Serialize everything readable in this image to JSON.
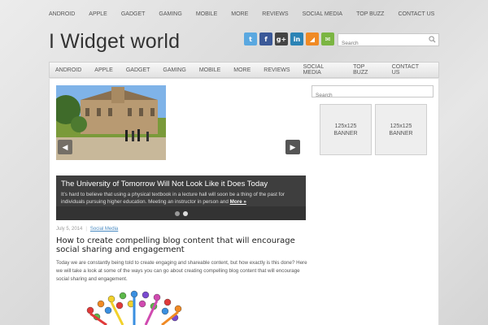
{
  "top_nav": [
    "ANDROID",
    "APPLE",
    "GADGET",
    "GAMING",
    "MOBILE",
    "MORE",
    "REVIEWS",
    "SOCIAL MEDIA",
    "TOP BUZZ",
    "CONTACT US"
  ],
  "site_title": "I Widget world",
  "social_icons": [
    {
      "name": "twitter-icon",
      "glyph": "t",
      "color": "#5aa8e0"
    },
    {
      "name": "facebook-icon",
      "glyph": "f",
      "color": "#3b5998"
    },
    {
      "name": "google-plus-icon",
      "glyph": "g+",
      "color": "#444"
    },
    {
      "name": "linkedin-icon",
      "glyph": "in",
      "color": "#2b83b5"
    },
    {
      "name": "rss-icon",
      "glyph": "◢",
      "color": "#f08a24"
    },
    {
      "name": "email-icon",
      "glyph": "✉",
      "color": "#7bb542"
    }
  ],
  "header_search": {
    "placeholder": "Search"
  },
  "main_nav": [
    "ANDROID",
    "APPLE",
    "GADGET",
    "GAMING",
    "MOBILE",
    "MORE",
    "REVIEWS",
    "SOCIAL MEDIA",
    "TOP BUZZ",
    "CONTACT US"
  ],
  "slider": {
    "title": "The University of Tomorrow Will Not Look Like it Does Today",
    "text": "It’s hard to believe that using a physical textbook in a lecture hall will soon be a thing of the past for individuals pursuing higher education. Meeting an instructor in person and",
    "more_label": "More »",
    "slide_count": 2,
    "active_slide": 1
  },
  "post": {
    "date": "July 5, 2014",
    "separator": "|",
    "category": "Social Media",
    "title": "How to create compelling blog content that will encourage social sharing and engagement",
    "excerpt": "Today we are constantly being told to create engaging and shareable content, but how exactly is this done? Here we will take a look at some of the ways you can go about creating compelling blog content that will encourage social sharing and engagement."
  },
  "sidebar": {
    "search_placeholder": "Search",
    "banners": [
      {
        "size": "125x125",
        "label": "BANNER"
      },
      {
        "size": "125x125",
        "label": "BANNER"
      }
    ]
  }
}
